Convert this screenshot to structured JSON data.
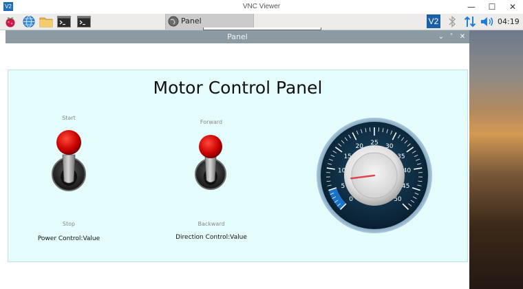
{
  "vnc": {
    "title": "VNC Viewer",
    "logo": "V2",
    "controls": {
      "minimize": "—",
      "maximize": "☐",
      "close": "✕"
    }
  },
  "taskbar": {
    "launchers": [
      "raspberry-menu-icon",
      "web-browser-icon",
      "file-manager-icon",
      "terminal-icon",
      "terminal-icon"
    ],
    "task_label": "Panel",
    "tray": [
      "vnc-server-icon",
      "bluetooth-icon",
      "network-icon",
      "volume-icon"
    ],
    "tray_vnc_text": "V2",
    "clock": "04:19"
  },
  "app": {
    "title": "Panel",
    "controls": {
      "minimize": "⌄",
      "maximize": "˄",
      "close": "✕"
    }
  },
  "panel": {
    "title": "Motor Control Panel",
    "power_switch": {
      "on_label": "Start",
      "off_label": "Stop",
      "value_label": "Power Control:Value"
    },
    "direction_switch": {
      "on_label": "Forward",
      "off_label": "Backward",
      "value_label": "Direction Control:Value"
    },
    "gauge": {
      "min": 0,
      "max": 50,
      "value": 7,
      "tick_labels": [
        "0",
        "5",
        "10",
        "15",
        "20",
        "25",
        "30",
        "35",
        "40",
        "45",
        "50"
      ],
      "colors": {
        "face": "#0d2a40",
        "ring": "#7fa6bf",
        "needle": "#e0454b",
        "low_band": "#1a73c9",
        "knob_light": "#f4f4f4"
      }
    }
  },
  "colors": {
    "panel_bg": "#e5fcfc",
    "knob_red": "#d40000",
    "app_titlebar": "#8c9aa4"
  }
}
